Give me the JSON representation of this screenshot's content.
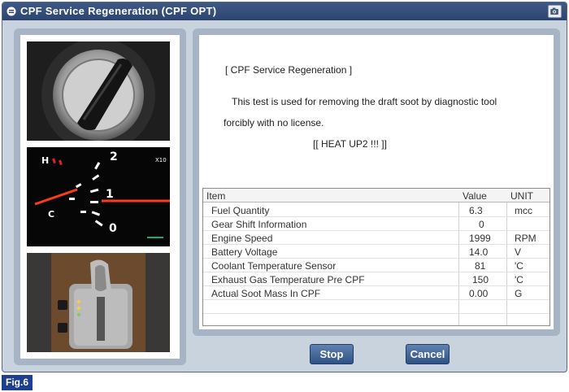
{
  "window": {
    "title": "CPF Service Regeneration (CPF OPT)",
    "title_icon": "window-menu-icon",
    "camera_icon": "camera-icon",
    "accent": "#2c4470"
  },
  "photos": [
    {
      "name": "ignition-key-photo"
    },
    {
      "name": "tachometer-photo"
    },
    {
      "name": "gear-shift-photo"
    }
  ],
  "message": {
    "heading": "[ CPF Service Regeneration ]",
    "line1": "This test is used for removing the draft soot by diagnostic tool",
    "line2": "forcibly with no license.",
    "line3": "[[ HEAT UP2 !!! ]]"
  },
  "table": {
    "headers": {
      "item": "Item",
      "value": "Value",
      "unit": "UNIT"
    },
    "rows": [
      {
        "item": "Fuel Quantity",
        "value": "6.3",
        "unit": "mcc"
      },
      {
        "item": "Gear Shift Information",
        "value": "0",
        "unit": ""
      },
      {
        "item": "Engine Speed",
        "value": "1999",
        "unit": "RPM"
      },
      {
        "item": "Battery Voltage",
        "value": "14.0",
        "unit": "V"
      },
      {
        "item": "Coolant Temperature Sensor",
        "value": "81",
        "unit": "'C"
      },
      {
        "item": "Exhaust Gas Temperature Pre CPF",
        "value": "150",
        "unit": "'C"
      },
      {
        "item": "Actual Soot Mass In CPF",
        "value": "0.00",
        "unit": "G"
      }
    ]
  },
  "buttons": {
    "stop": "Stop",
    "cancel": "Cancel"
  },
  "figure_label": "Fig.6"
}
